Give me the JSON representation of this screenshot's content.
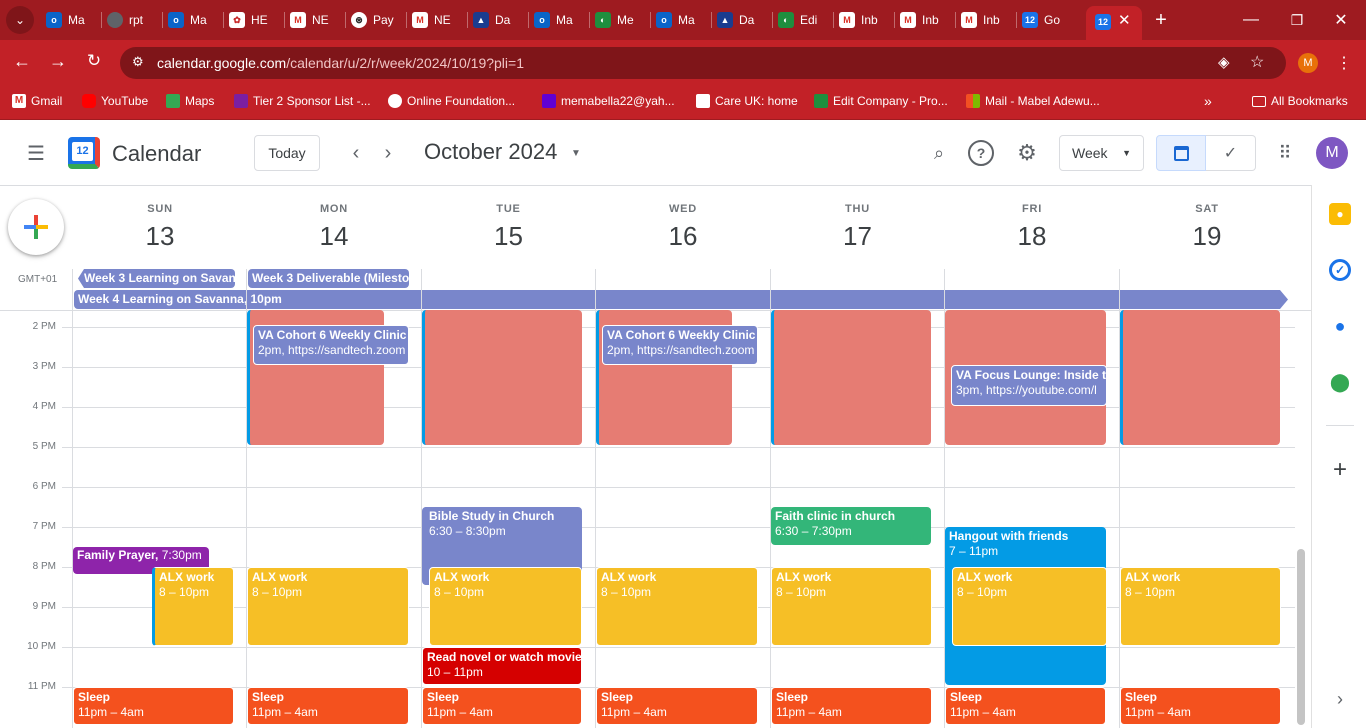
{
  "browser": {
    "tabs": [
      {
        "label": "Ma",
        "icon": "outlook-icon"
      },
      {
        "label": "rpt",
        "icon": "globe-icon"
      },
      {
        "label": "Ma",
        "icon": "outlook-icon"
      },
      {
        "label": "HE",
        "icon": "he-icon"
      },
      {
        "label": "NE",
        "icon": "gmail-icon"
      },
      {
        "label": "Pay",
        "icon": "chatgpt-icon"
      },
      {
        "label": "NE",
        "icon": "gmail-icon"
      },
      {
        "label": "Da",
        "icon": "da-icon"
      },
      {
        "label": "Ma",
        "icon": "outlook-icon"
      },
      {
        "label": "Me",
        "icon": "green-icon"
      },
      {
        "label": "Ma",
        "icon": "outlook-icon"
      },
      {
        "label": "Da",
        "icon": "da-icon"
      },
      {
        "label": "Edi",
        "icon": "green-icon"
      },
      {
        "label": "Inb",
        "icon": "gmail-icon"
      },
      {
        "label": "Inb",
        "icon": "gmail-icon"
      },
      {
        "label": "Inb",
        "icon": "gmail-icon"
      },
      {
        "label": "Go",
        "icon": "calendar-icon"
      }
    ],
    "url_host": "calendar.google.com",
    "url_path": "/calendar/u/2/r/week/2024/10/19?pli=1",
    "profile_initial": "M",
    "bookmarks": [
      {
        "label": "Gmail"
      },
      {
        "label": "YouTube"
      },
      {
        "label": "Maps"
      },
      {
        "label": "Tier 2 Sponsor List -..."
      },
      {
        "label": "Online Foundation..."
      },
      {
        "label": "memabella22@yah..."
      },
      {
        "label": "Care UK: home"
      },
      {
        "label": "Edit Company - Pro..."
      },
      {
        "label": "Mail - Mabel Adewu..."
      }
    ],
    "all_bookmarks": "All Bookmarks"
  },
  "calendar": {
    "app_name": "Calendar",
    "logo_day": "12",
    "today_button": "Today",
    "month_title": "October 2024",
    "view_select": "Week",
    "avatar_initial": "M",
    "timezone": "GMT+01",
    "days": [
      {
        "name": "SUN",
        "num": "13"
      },
      {
        "name": "MON",
        "num": "14"
      },
      {
        "name": "TUE",
        "num": "15"
      },
      {
        "name": "WED",
        "num": "16"
      },
      {
        "name": "THU",
        "num": "17"
      },
      {
        "name": "FRI",
        "num": "18"
      },
      {
        "name": "SAT",
        "num": "19"
      }
    ],
    "hours": [
      "2 PM",
      "3 PM",
      "4 PM",
      "5 PM",
      "6 PM",
      "7 PM",
      "8 PM",
      "9 PM",
      "10 PM",
      "11 PM"
    ],
    "allday": [
      {
        "title": "Week 3 Learning on Savanr"
      },
      {
        "title": "Week 3 Deliverable (Milestor"
      },
      {
        "title": "Week 4 Learning on Savanna, 10pm"
      }
    ],
    "events": {
      "va_cohort_title": "VA Cohort 6 Weekly Clinic -",
      "va_cohort_time": "2pm, https://sandtech.zoom",
      "va_focus_title": "VA Focus Lounge: Inside th",
      "va_focus_time": "3pm, https://youtube.com/l",
      "bible_title": "Bible Study in Church",
      "bible_time": "6:30 – 8:30pm",
      "faith_title": "Faith clinic in church",
      "faith_time": "6:30 – 7:30pm",
      "hangout_title": "Hangout with friends",
      "hangout_time": "7 – 11pm",
      "prayer_title": "Family Prayer,",
      "prayer_time": "7:30pm",
      "alx_title": "ALX work",
      "alx_time": "8 – 10pm",
      "novel_title": "Read novel or watch movie",
      "novel_time": "10 – 11pm",
      "sleep_title": "Sleep",
      "sleep_time": "11pm – 4am"
    }
  }
}
